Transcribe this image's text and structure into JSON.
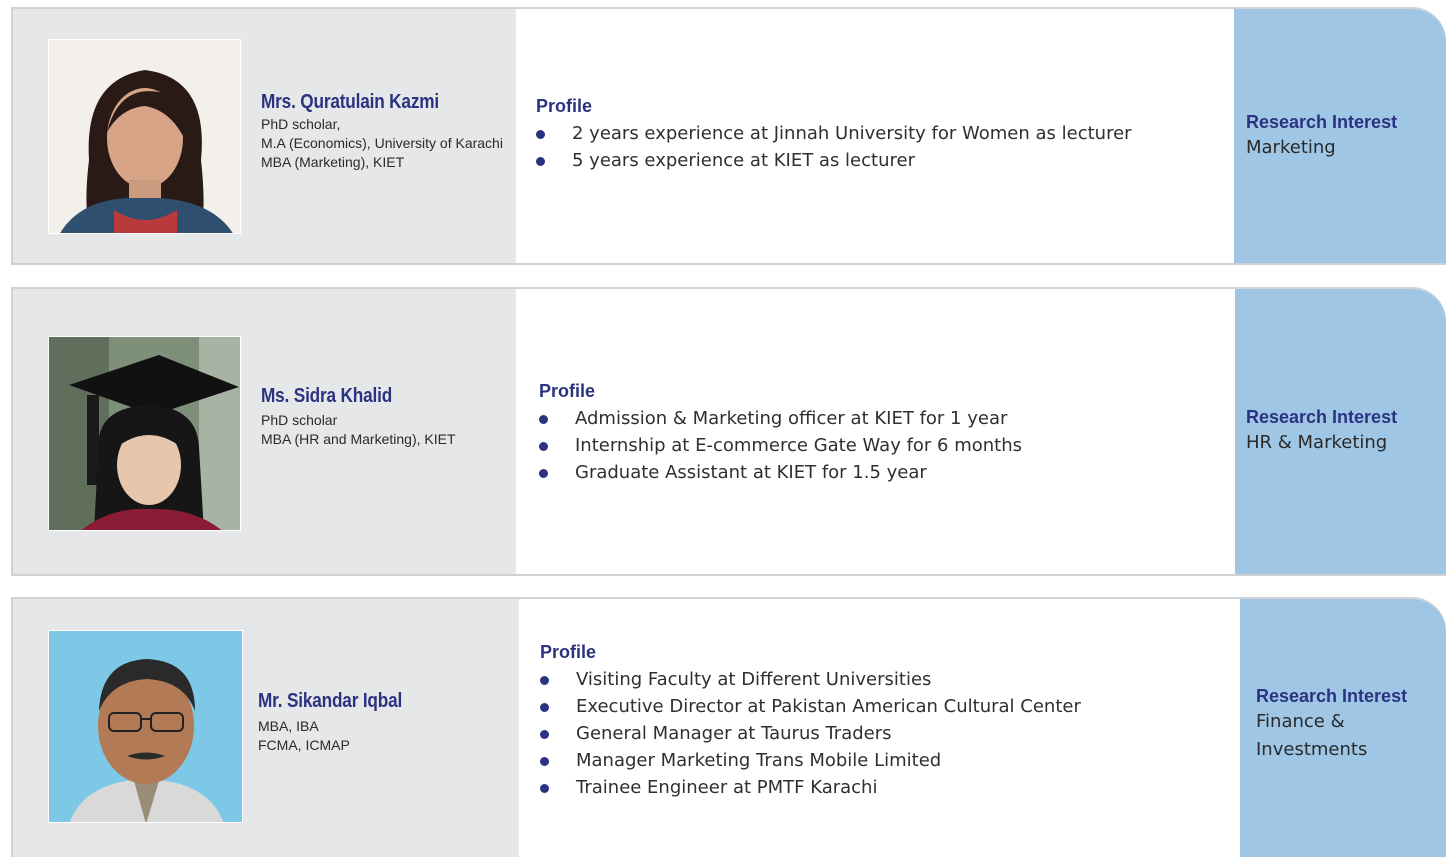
{
  "faculty": [
    {
      "name": "Mrs. Quratulain Kazmi",
      "qualifications": [
        "PhD scholar,",
        "M.A (Economics), University of Karachi",
        "MBA (Marketing), KIET"
      ],
      "profile_title": "Profile",
      "profile": [
        "2 years experience at Jinnah University for Women as lecturer",
        "5 years experience at KIET as lecturer"
      ],
      "research_title": "Research Interest",
      "research": "Marketing"
    },
    {
      "name": "Ms. Sidra Khalid",
      "qualifications": [
        "PhD scholar",
        "MBA (HR and Marketing), KIET"
      ],
      "profile_title": "Profile",
      "profile": [
        "Admission & Marketing officer at KIET for 1 year",
        "Internship at E-commerce Gate Way for 6 months",
        "Graduate Assistant at KIET for 1.5 year"
      ],
      "research_title": "Research Interest",
      "research": "HR & Marketing"
    },
    {
      "name": "Mr. Sikandar Iqbal",
      "qualifications": [
        "MBA, IBA",
        "FCMA, ICMAP"
      ],
      "profile_title": "Profile",
      "profile": [
        "Visiting Faculty at Different Universities",
        "Executive Director at Pakistan American Cultural Center",
        "General Manager at Taurus Traders",
        "Manager Marketing Trans Mobile Limited",
        "Trainee Engineer at PMTF Karachi"
      ],
      "research_title": "Research Interest",
      "research": "Finance & Investments"
    }
  ],
  "colors": {
    "heading": "#2b3381",
    "left_panel": "#e6e7e9",
    "research_panel": "#9fc7e5",
    "border": "#cfd1d5"
  }
}
